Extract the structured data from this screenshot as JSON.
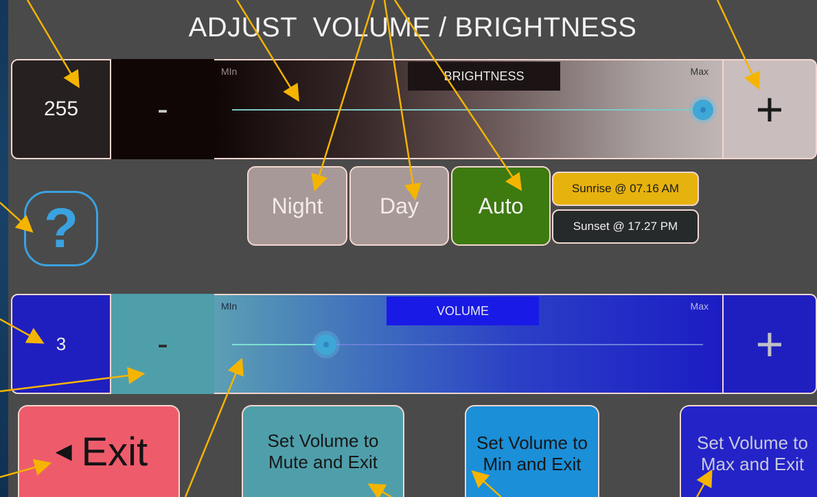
{
  "title": "ADJUST  VOLUME / BRIGHTNESS",
  "brightness": {
    "value": "255",
    "minus_label": "-",
    "plus_label": "+",
    "badge": "BRIGHTNESS",
    "min_label": "MIn",
    "max_label": "Max",
    "level_fraction": 1.0
  },
  "modes": {
    "night": "Night",
    "day": "Day",
    "auto": "Auto",
    "sunrise": "Sunrise @ 07.16 AM",
    "sunset": "Sunset @ 17.27 PM"
  },
  "help": {
    "label": "?",
    "icon": "help-question-icon"
  },
  "volume": {
    "value": "3",
    "minus_label": "-",
    "plus_label": "+",
    "badge": "VOLUME",
    "min_label": "MIn",
    "max_label": "Max",
    "level_fraction": 0.2
  },
  "buttons": {
    "exit_arrow": "◄",
    "exit": "Exit",
    "mute_exit": "Set Volume to Mute and Exit",
    "min_exit": "Set Volume to Min and Exit",
    "max_exit": "Set Volume to Max and Exit"
  },
  "colors": {
    "annotation_arrow": "#f5b400",
    "auto_active": "#3d7a10",
    "sunrise": "#e6b20e",
    "exit": "#ee5c6c"
  }
}
